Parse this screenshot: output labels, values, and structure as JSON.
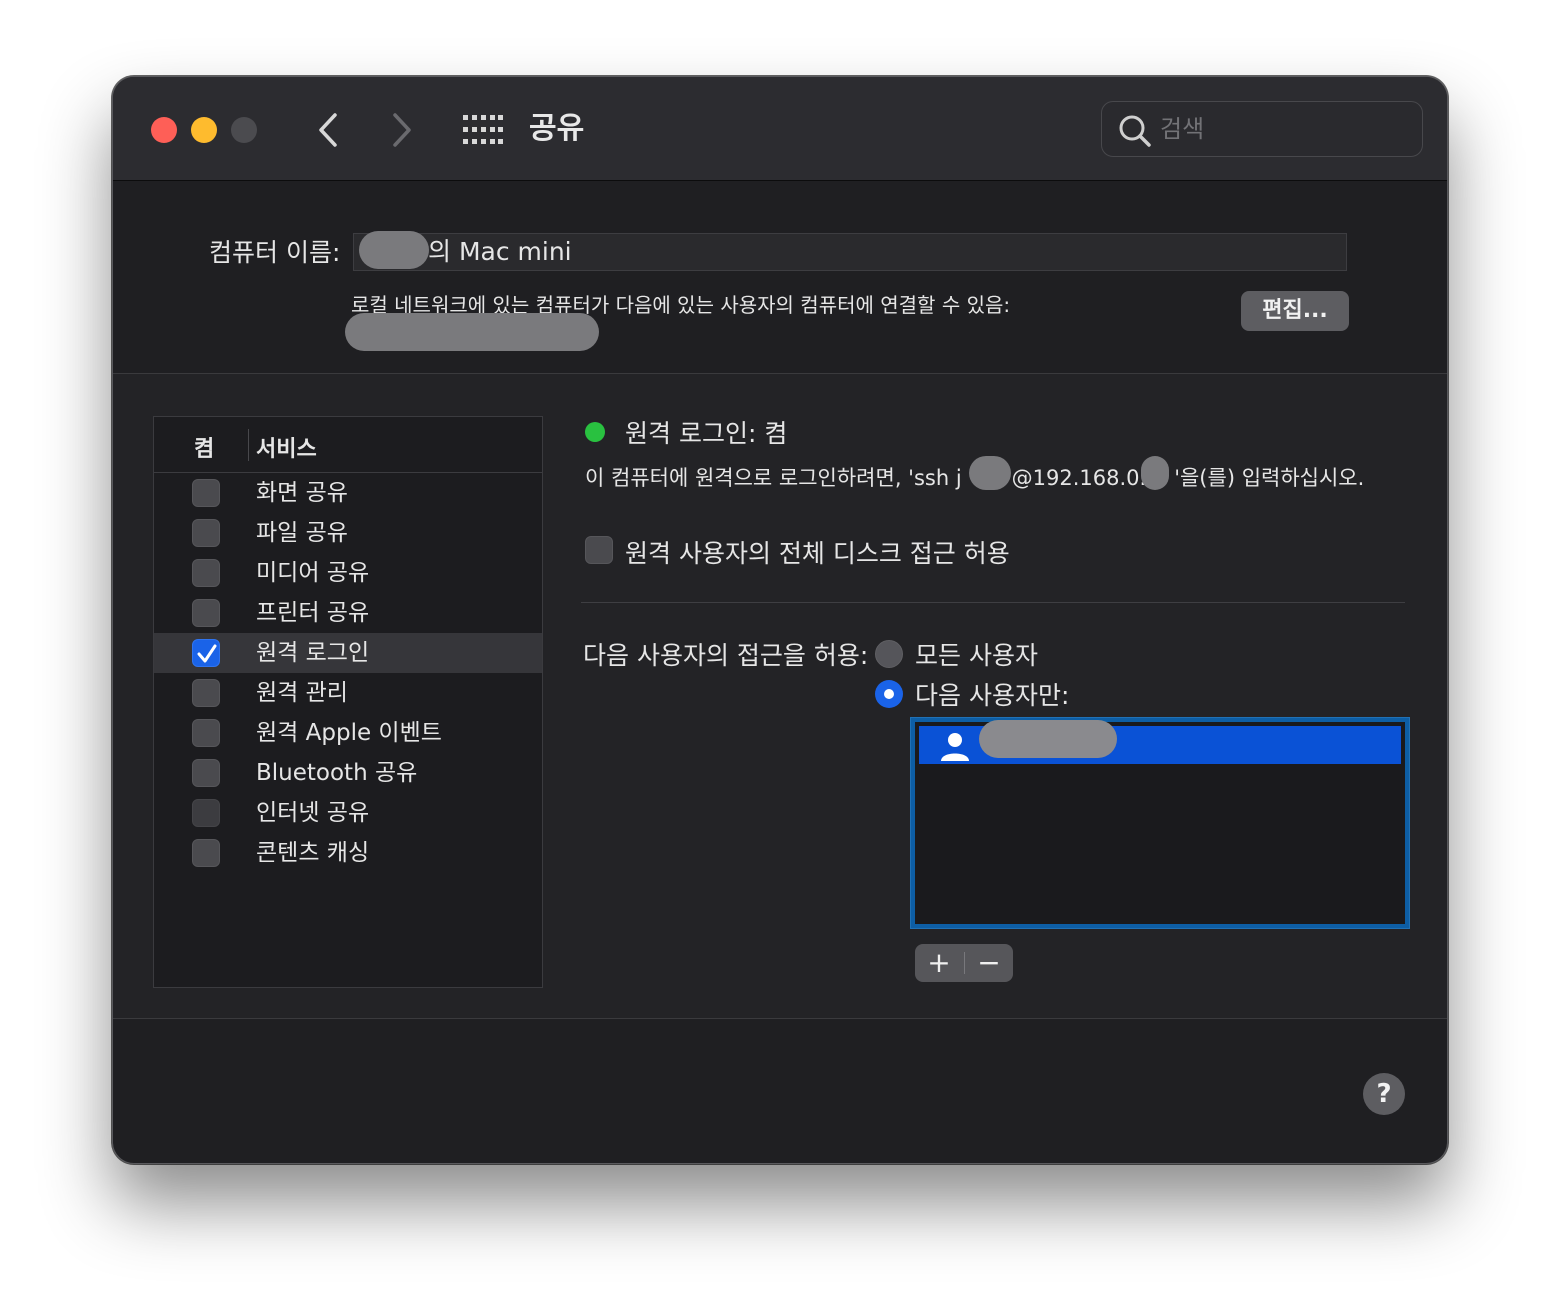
{
  "window": {
    "title": "공유",
    "search_placeholder": "검색",
    "icons": {
      "back": "chevron-left-icon",
      "forward": "chevron-right-icon",
      "grid": "grid-icon",
      "search": "magnifier-icon"
    }
  },
  "computer": {
    "name_label": "컴퓨터 이름:",
    "name_value_visible": "의 Mac mini",
    "local_desc": "로컬 네트워크에 있는 컴퓨터가 다음에 있는 사용자의 컴퓨터에 연결할 수 있음:",
    "edit_button": "편집..."
  },
  "services": {
    "header_on": "켬",
    "header_service": "서비스",
    "items": [
      {
        "label": "화면 공유",
        "checked": false
      },
      {
        "label": "파일 공유",
        "checked": false
      },
      {
        "label": "미디어 공유",
        "checked": false
      },
      {
        "label": "프린터 공유",
        "checked": false
      },
      {
        "label": "원격 로그인",
        "checked": true
      },
      {
        "label": "원격 관리",
        "checked": false
      },
      {
        "label": "원격 Apple 이벤트",
        "checked": false
      },
      {
        "label": "Bluetooth 공유",
        "checked": false
      },
      {
        "label": "인터넷 공유",
        "checked": false
      },
      {
        "label": "콘텐츠 캐싱",
        "checked": false
      }
    ]
  },
  "detail": {
    "status": "원격 로그인: 켬",
    "status_color": "#29c140",
    "ssh_prefix": "이 컴퓨터에 원격으로 로그인하려면, 'ssh j",
    "ssh_middle": "@192.168.0.",
    "ssh_suffix": "'을(를) 입력하십시오.",
    "full_disk_access": "원격 사용자의 전체 디스크 접근 허용",
    "allow_label": "다음 사용자의 접근을 허용:",
    "radio_all": "모든 사용자",
    "radio_only": "다음 사용자만:",
    "selected_radio": "only",
    "add_button": "+",
    "remove_button": "−",
    "user_icon": "person-icon"
  },
  "help_button": "?",
  "colors": {
    "accent": "#1a63e8",
    "selection": "#0a52d6",
    "close": "#fe5f57",
    "minimize": "#febb2e"
  }
}
